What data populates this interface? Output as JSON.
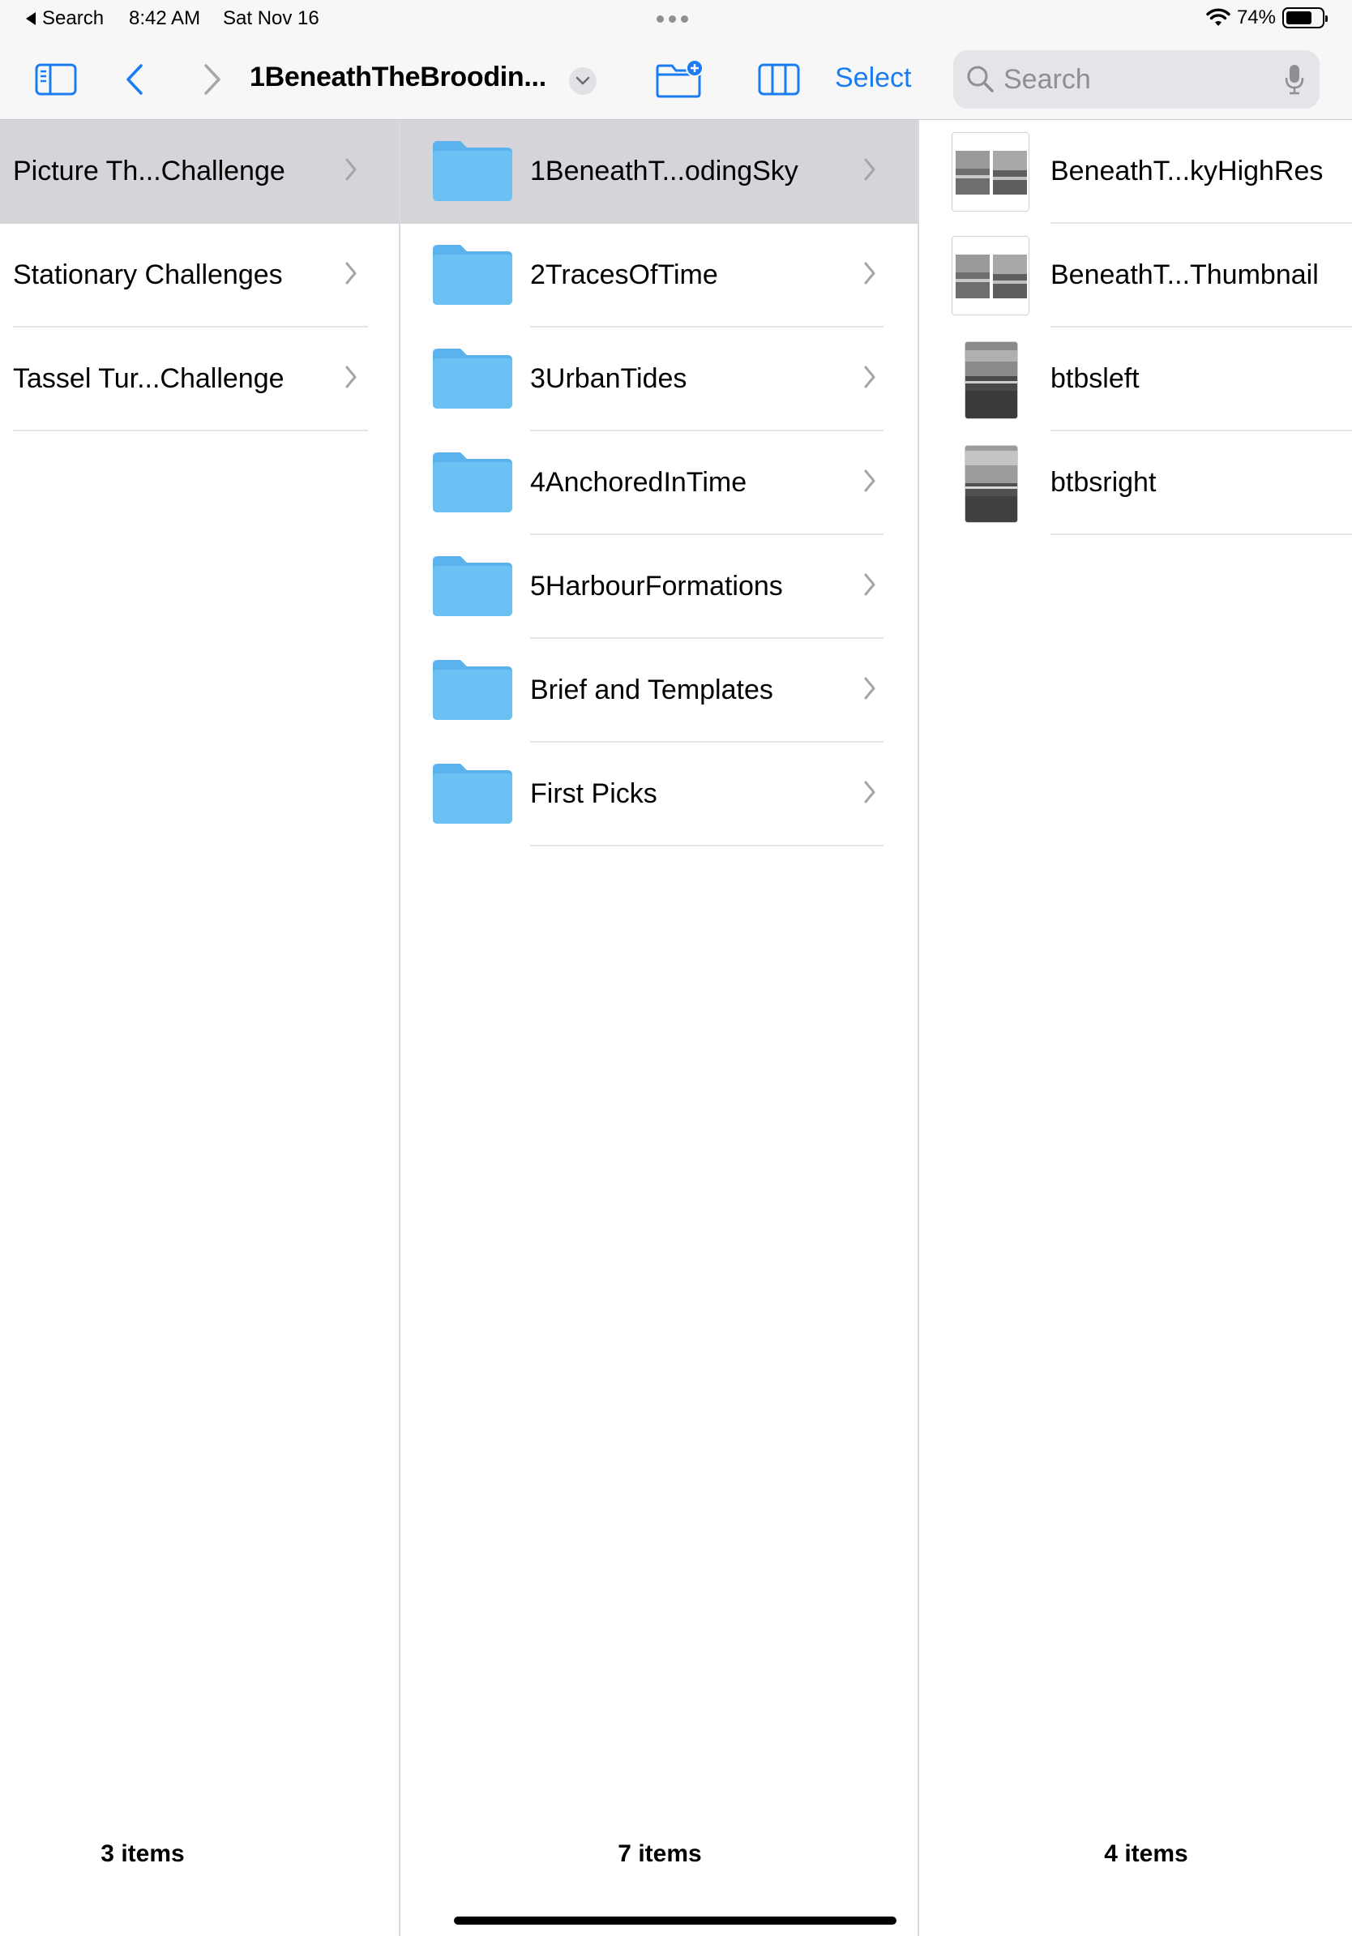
{
  "status_bar": {
    "back_label": "Search",
    "time": "8:42 AM",
    "date": "Sat Nov 16",
    "battery_percent": "74%",
    "battery_level": 0.74
  },
  "toolbar": {
    "title": "1BeneathTheBroodin...",
    "select_label": "Select",
    "search_placeholder": "Search",
    "accent_color": "#1a7cf0"
  },
  "columns": [
    {
      "items": [
        {
          "label": "Picture Th...Challenge",
          "selected": true
        },
        {
          "label": "Stationary Challenges",
          "selected": false
        },
        {
          "label": "Tassel Tur...Challenge",
          "selected": false
        }
      ],
      "count": "3 items"
    },
    {
      "items": [
        {
          "label": "1BeneathT...odingSky",
          "selected": true,
          "icon": "folder-icon"
        },
        {
          "label": "2TracesOfTime",
          "selected": false,
          "icon": "folder-icon"
        },
        {
          "label": "3UrbanTides",
          "selected": false,
          "icon": "folder-icon"
        },
        {
          "label": "4AnchoredInTime",
          "selected": false,
          "icon": "folder-icon"
        },
        {
          "label": "5HarbourFormations",
          "selected": false,
          "icon": "folder-icon"
        },
        {
          "label": "Brief and Templates",
          "selected": false,
          "icon": "folder-icon"
        },
        {
          "label": "First Picks",
          "selected": false,
          "icon": "folder-icon"
        }
      ],
      "count": "7 items"
    },
    {
      "items": [
        {
          "label": "BeneathT...kyHighRes",
          "icon": "image-thumbnail-icon"
        },
        {
          "label": "BeneathT...Thumbnail",
          "icon": "image-thumbnail-icon"
        },
        {
          "label": "btbsleft",
          "icon": "image-thumbnail-icon"
        },
        {
          "label": "btbsright",
          "icon": "image-thumbnail-icon"
        }
      ],
      "count": "4 items"
    }
  ]
}
